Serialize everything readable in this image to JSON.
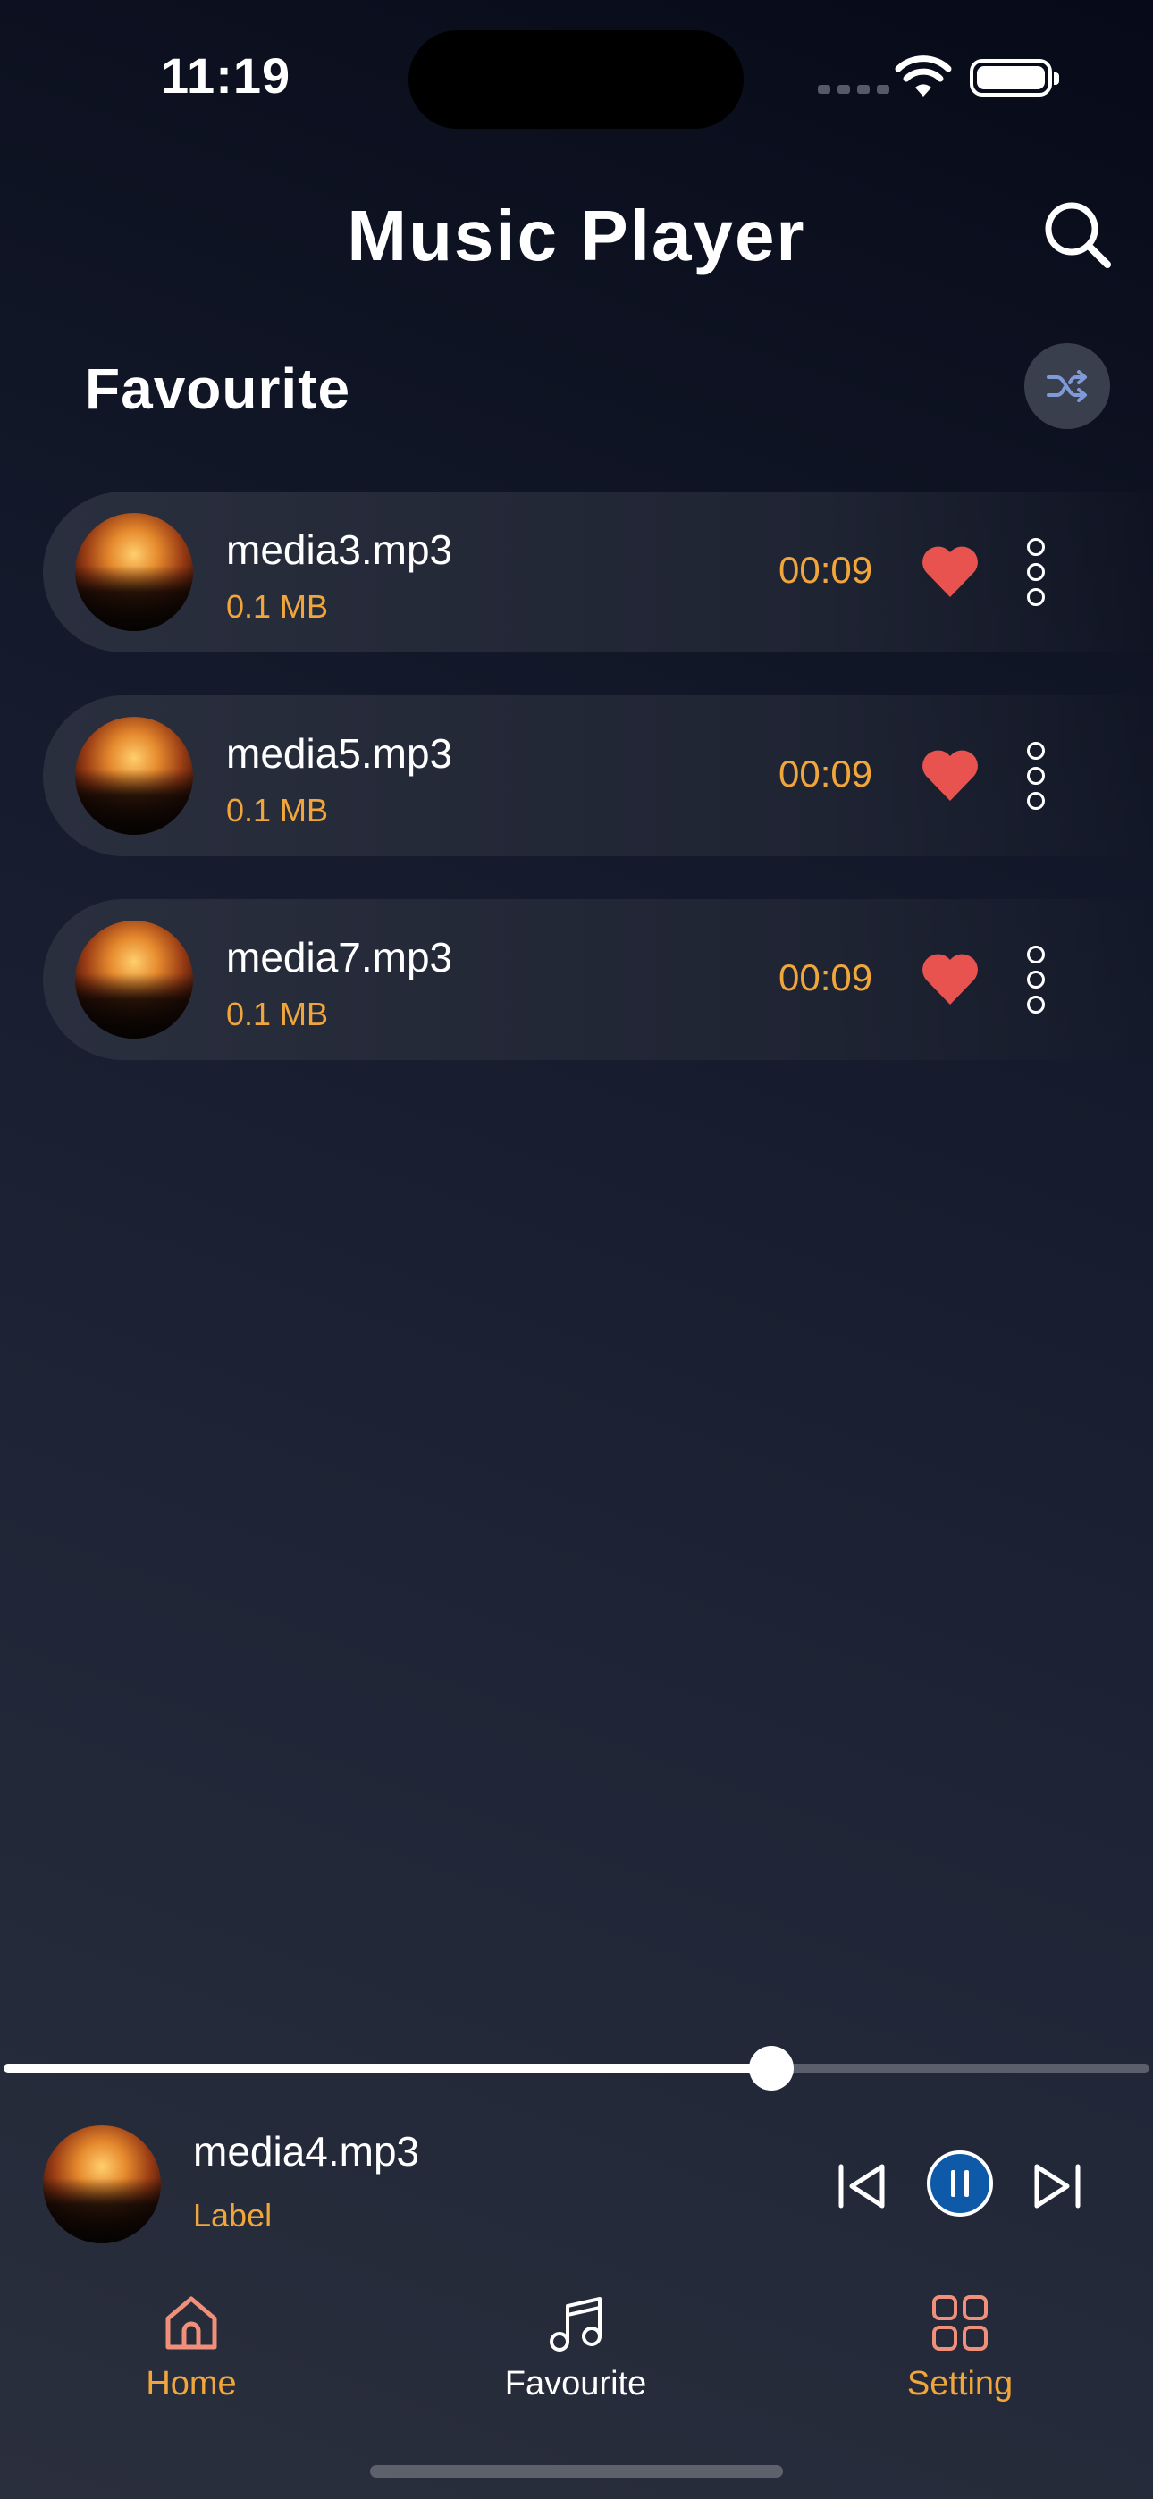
{
  "status_bar": {
    "time": "11:19"
  },
  "header": {
    "title": "Music Player",
    "search_icon": "search-icon"
  },
  "section": {
    "title": "Favourite",
    "shuffle_icon": "shuffle-icon"
  },
  "tracks": [
    {
      "name": "media3.mp3",
      "size": "0.1 MB",
      "duration": "00:09",
      "favourite": true
    },
    {
      "name": "media5.mp3",
      "size": "0.1 MB",
      "duration": "00:09",
      "favourite": true
    },
    {
      "name": "media7.mp3",
      "size": "0.1 MB",
      "duration": "00:09",
      "favourite": true
    }
  ],
  "player": {
    "title": "media4.mp3",
    "label": "Label",
    "progress": 0.67,
    "state": "playing"
  },
  "nav": {
    "items": [
      {
        "label": "Home",
        "icon": "home-icon"
      },
      {
        "label": "Favourite",
        "icon": "music-note-icon"
      },
      {
        "label": "Setting",
        "icon": "grid-icon"
      }
    ]
  },
  "colors": {
    "accent": "#f0a63a",
    "heart": "#e8534f",
    "pause_button": "#0e5aa8",
    "nav_icon": "#f0907a"
  }
}
